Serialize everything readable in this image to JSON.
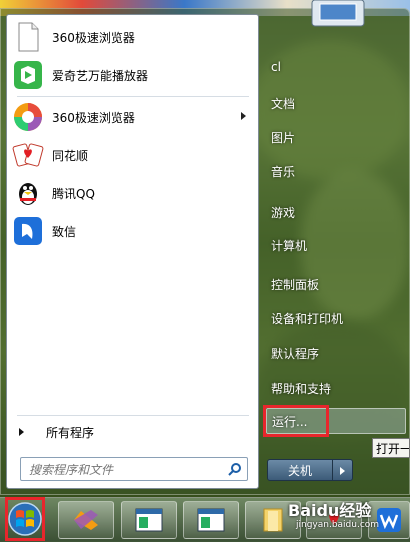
{
  "left_pane": {
    "pinned_programs": [
      {
        "label": "360极速浏览器",
        "icon": "document-icon"
      },
      {
        "label": "爱奇艺万能播放器",
        "icon": "iqiyi-icon"
      }
    ],
    "recent_programs": [
      {
        "label": "360极速浏览器",
        "icon": "360-browser-icon",
        "has_submenu": true
      },
      {
        "label": "同花顺",
        "icon": "tonghuashun-icon"
      },
      {
        "label": "腾讯QQ",
        "icon": "qq-penguin-icon"
      },
      {
        "label": "致信",
        "icon": "zhixin-bird-icon"
      }
    ],
    "all_programs_label": "所有程序",
    "search_placeholder": "搜索程序和文件"
  },
  "right_pane": {
    "items": [
      "cl",
      "文档",
      "图片",
      "音乐",
      "游戏",
      "计算机",
      "控制面板",
      "设备和打印机",
      "默认程序",
      "帮助和支持"
    ],
    "run_label": "运行...",
    "tooltip": "打开一",
    "shutdown_label": "关机"
  },
  "watermark": {
    "brand": "Baidu经验",
    "url": "jingyan.baidu.com"
  },
  "colors": {
    "highlight": "#e8262c"
  }
}
